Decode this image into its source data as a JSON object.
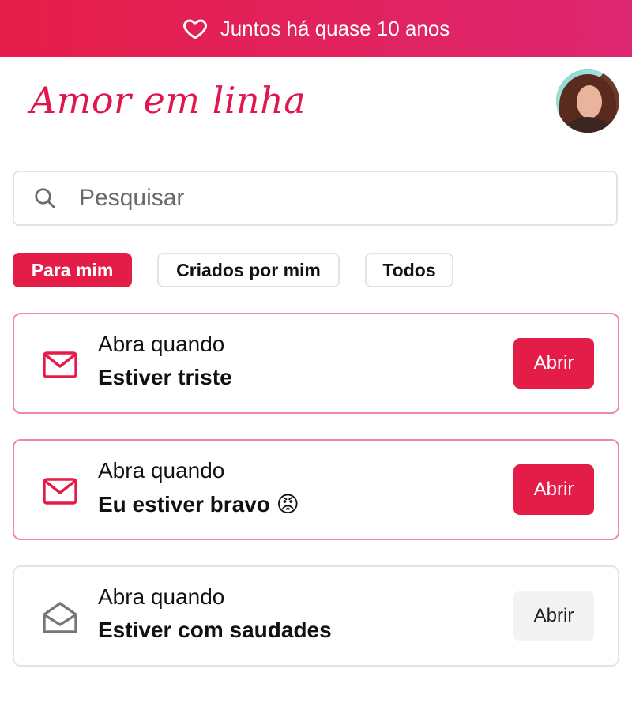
{
  "banner": {
    "text": "Juntos há quase 10 anos",
    "icon": "heart-outline-icon"
  },
  "header": {
    "logo": "Amor em linha",
    "avatar": "profile-photo"
  },
  "search": {
    "placeholder": "Pesquisar",
    "value": "",
    "icon": "search-icon"
  },
  "filters": [
    {
      "label": "Para mim",
      "active": true
    },
    {
      "label": "Criados por mim",
      "active": false
    },
    {
      "label": "Todos",
      "active": false
    }
  ],
  "letters": [
    {
      "prefix": "Abra quando",
      "title": "Estiver triste",
      "button": "Abrir",
      "state": "unread",
      "icon": "envelope-closed-icon"
    },
    {
      "prefix": "Abra quando",
      "title": "Eu estiver bravo 😡",
      "button": "Abrir",
      "state": "unread",
      "icon": "envelope-closed-icon"
    },
    {
      "prefix": "Abra quando",
      "title": "Estiver com saudades",
      "button": "Abrir",
      "state": "read",
      "icon": "envelope-open-icon"
    }
  ],
  "colors": {
    "accent": "#e31c48",
    "banner_start": "#e61e49",
    "banner_end": "#dd2670",
    "unread_border": "#ee8a9e",
    "read_border": "#e3e3e3"
  }
}
